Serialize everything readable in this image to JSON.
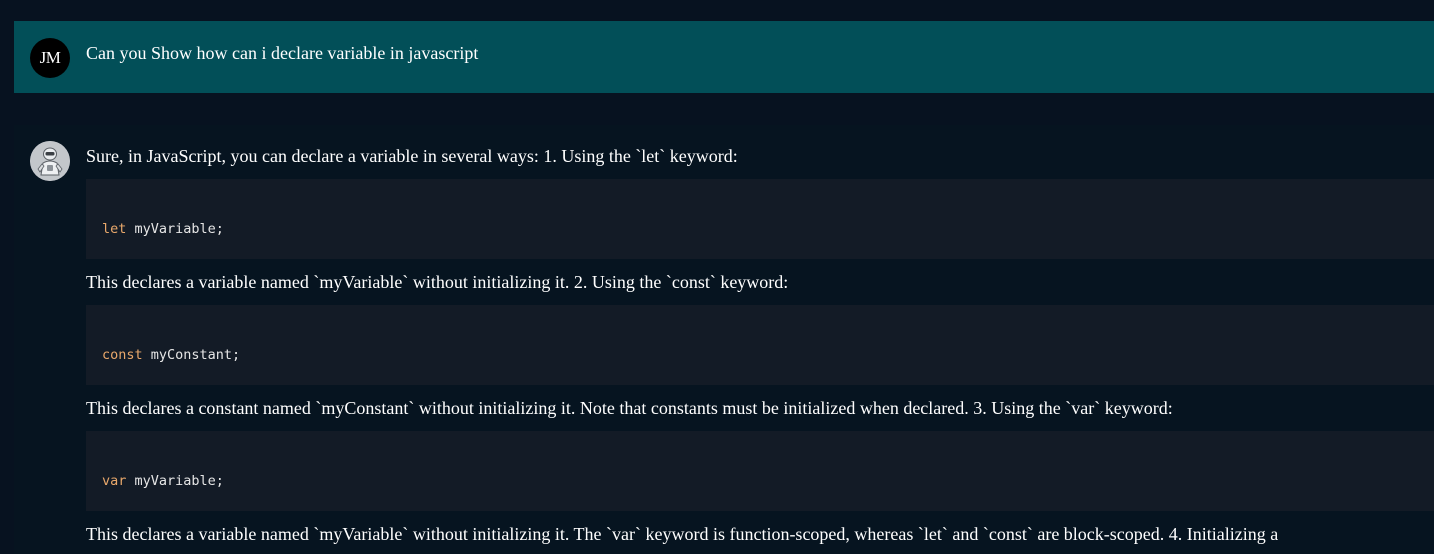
{
  "user_message": {
    "initials": "JM",
    "text": "Can you Show how can i declare variable in javascript"
  },
  "assistant_message": {
    "avatar_icon": "robot-avatar-icon",
    "intro": "Sure, in JavaScript, you can declare a variable in several ways: 1. Using the `let` keyword:",
    "code_blocks": [
      {
        "keyword": "let",
        "rest": " myVariable;"
      },
      {
        "keyword": "const",
        "rest": " myConstant;"
      },
      {
        "keyword": "var",
        "rest": " myVariable;"
      }
    ],
    "after_let": "This declares a variable named `myVariable` without initializing it. 2. Using the `const` keyword:",
    "after_const": "This declares a constant named `myConstant` without initializing it. Note that constants must be initialized when declared. 3. Using the `var` keyword:",
    "after_var": "This declares a variable named `myVariable` without initializing it. The `var` keyword is function-scoped, whereas `let` and `const` are block-scoped. 4. Initializing a"
  },
  "colors": {
    "user_bg": "#024f58",
    "page_bg": "#071220",
    "code_bg": "#131b26",
    "keyword": "#e9a86b"
  }
}
